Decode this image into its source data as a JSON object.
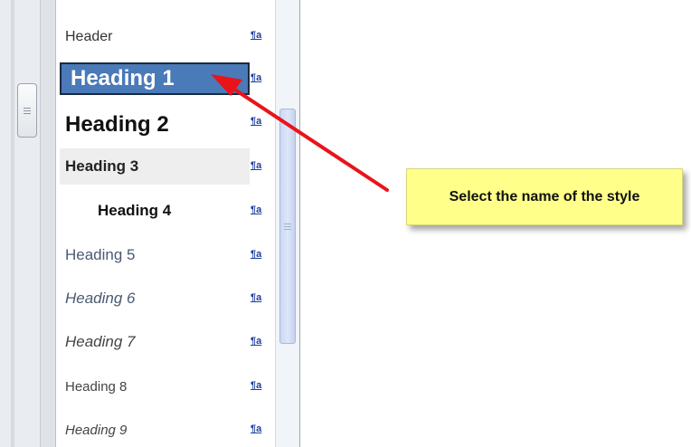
{
  "styles_pane": {
    "items": [
      {
        "label": "Header",
        "marker": "¶a"
      },
      {
        "label": "Heading 1",
        "marker": "¶a"
      },
      {
        "label": "Heading 2",
        "marker": "¶a"
      },
      {
        "label": "Heading 3",
        "marker": "¶a"
      },
      {
        "label": "Heading 4",
        "marker": "¶a"
      },
      {
        "label": "Heading 5",
        "marker": "¶a"
      },
      {
        "label": "Heading 6",
        "marker": "¶a"
      },
      {
        "label": "Heading 7",
        "marker": "¶a"
      },
      {
        "label": "Heading 8",
        "marker": "¶a"
      },
      {
        "label": "Heading 9",
        "marker": "¶a"
      }
    ],
    "selected_item": "Heading 1",
    "selected_color": "#4a7ab8"
  },
  "callout": {
    "text": "Select the name of the style",
    "background": "#ffff8a"
  },
  "annotation": {
    "arrow_color": "#e8141a"
  }
}
